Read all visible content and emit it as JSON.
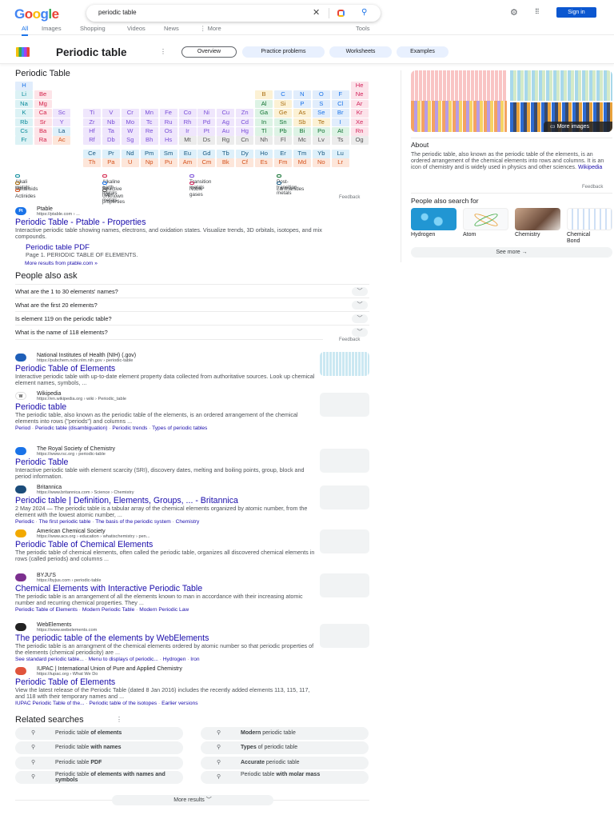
{
  "header": {
    "logo": "Google",
    "query": "periodic table",
    "sign_in": "Sign in",
    "tabs": [
      "All",
      "Images",
      "Shopping",
      "Videos",
      "News",
      "⋮ More"
    ],
    "tools": "Tools"
  },
  "kp": {
    "title": "Periodic table",
    "chips": [
      "Overview",
      "Practice problems",
      "Worksheets",
      "Examples"
    ],
    "table_heading": "Periodic Table",
    "rows": [
      [
        "H:nm",
        null,
        null,
        null,
        null,
        null,
        null,
        null,
        null,
        null,
        null,
        null,
        null,
        null,
        null,
        null,
        null,
        "He:ng"
      ],
      [
        "Li:al",
        "Be:ae",
        null,
        null,
        null,
        null,
        null,
        null,
        null,
        null,
        null,
        null,
        "B:md",
        "C:nm",
        "N:nm",
        "O:nm",
        "F:nm",
        "Ne:ng"
      ],
      [
        "Na:al",
        "Mg:ae",
        null,
        null,
        null,
        null,
        null,
        null,
        null,
        null,
        null,
        null,
        "Al:pt",
        "Si:md",
        "P:nm",
        "S:nm",
        "Cl:nm",
        "Ar:ng"
      ],
      [
        "K:al",
        "Ca:ae",
        "Sc:tm",
        "Ti:tm",
        "V:tm",
        "Cr:tm",
        "Mn:tm",
        "Fe:tm",
        "Co:tm",
        "Ni:tm",
        "Cu:tm",
        "Zn:tm",
        "Ga:pt",
        "Ge:md",
        "As:md",
        "Se:nm",
        "Br:nm",
        "Kr:ng"
      ],
      [
        "Rb:al",
        "Sr:ae",
        "Y:tm",
        "Zr:tm",
        "Nb:tm",
        "Mo:tm",
        "Tc:tm",
        "Ru:tm",
        "Rh:tm",
        "Pd:tm",
        "Ag:tm",
        "Cd:tm",
        "In:pt",
        "Sn:pt",
        "Sb:md",
        "Te:md",
        "I:nm",
        "Xe:ng"
      ],
      [
        "Cs:al",
        "Ba:ae",
        "La:ln",
        "Hf:tm",
        "Ta:tm",
        "W:tm",
        "Re:tm",
        "Os:tm",
        "Ir:tm",
        "Pt:tm",
        "Au:tm",
        "Hg:tm",
        "Tl:pt",
        "Pb:pt",
        "Bi:pt",
        "Po:pt",
        "At:pt",
        "Rn:ng"
      ],
      [
        "Fr:al",
        "Ra:ae",
        "Ac:ac",
        "Rf:tm",
        "Db:tm",
        "Sg:tm",
        "Bh:tm",
        "Hs:tm",
        "Mt:un",
        "Ds:un",
        "Rg:un",
        "Cn:un",
        "Nh:un",
        "Fl:un",
        "Mc:un",
        "Lv:un",
        "Ts:un",
        "Og:un"
      ]
    ],
    "lanthanides": [
      "Ce",
      "Pr",
      "Nd",
      "Pm",
      "Sm",
      "Eu",
      "Gd",
      "Tb",
      "Dy",
      "Ho",
      "Er",
      "Tm",
      "Yb",
      "Lu"
    ],
    "actinides": [
      "Th",
      "Pa",
      "U",
      "Np",
      "Pu",
      "Am",
      "Cm",
      "Bk",
      "Cf",
      "Es",
      "Fm",
      "Md",
      "No",
      "Lr"
    ],
    "categories": {
      "al": {
        "label": "Alkali metals",
        "bg": "#dcf2f5",
        "fg": "#0a8a9a"
      },
      "ae": {
        "label": "Alkaline earth metals",
        "bg": "#fde4e8",
        "fg": "#d3224a"
      },
      "tm": {
        "label": "Transition metals",
        "bg": "#efe6fc",
        "fg": "#7a4fd8"
      },
      "pt": {
        "label": "Post-transition metals",
        "bg": "#ddf3e5",
        "fg": "#137333"
      },
      "md": {
        "label": "Metalloids",
        "bg": "#fcf1d4",
        "fg": "#a86c0f"
      },
      "nm": {
        "label": "Reactive non-metals",
        "bg": "#e1edfc",
        "fg": "#1a73e8"
      },
      "ng": {
        "label": "Noble gases",
        "bg": "#fce3ea",
        "fg": "#d2245b"
      },
      "ln": {
        "label": "Lanthanides",
        "bg": "#def0fa",
        "fg": "#185a83"
      },
      "ac": {
        "label": "Actinides",
        "bg": "#fde6da",
        "fg": "#d4531d"
      },
      "un": {
        "label": "Unknown properties",
        "bg": "#ececec",
        "fg": "#555555"
      }
    },
    "legend_order": [
      "al",
      "ae",
      "tm",
      "pt",
      "md",
      "nm",
      "ng",
      "ln",
      "ac",
      "un"
    ],
    "feedback": "Feedback"
  },
  "panel": {
    "more_images": "More images",
    "about_heading": "About",
    "about_text": "The periodic table, also known as the periodic table of the elements, is an ordered arrangement of the chemical elements into rows and columns. It is an icon of chemistry and is widely used in physics and other sciences.",
    "about_source": "Wikipedia",
    "feedback": "Feedback",
    "pasf_heading": "People also search for",
    "pasf": [
      "Hydrogen",
      "Atom",
      "Chemistry",
      "Chemical Bond"
    ],
    "see_more": "See more"
  },
  "ptable": {
    "site": "Ptable",
    "url": "https://ptable.com › ...",
    "title": "Periodic Table - Ptable - Properties",
    "snippet": "Interactive periodic table showing names, electrons, and oxidation states. Visualize trends, 3D orbitals, isotopes, and mix compounds.",
    "sub_title": "Periodic table PDF",
    "sub_snippet": "Page 1. PERIODIC TABLE OF ELEMENTS.",
    "more": "More results from ptable.com »"
  },
  "paa": {
    "heading": "People also ask",
    "questions": [
      "What are the 1 to 30 elements' names?",
      "What are the first 20 elements?",
      "Is element 119 on the periodic table?",
      "What is the name of 118 elements?"
    ],
    "feedback": "Feedback"
  },
  "results": [
    {
      "site": "National Institutes of Health (NIH) (.gov)",
      "url": "https://pubchem.ncbi.nlm.nih.gov › periodic-table",
      "title": "Periodic Table of Elements",
      "snippet": "Interactive periodic table with up-to-date element property data collected from authoritative sources. Look up chemical element names, symbols, ...",
      "links": [],
      "fav": "#1f5fb8"
    },
    {
      "site": "Wikipedia",
      "url": "https://en.wikipedia.org › wiki › Periodic_table",
      "title": "Periodic table",
      "snippet": "The periodic table, also known as the periodic table of the elements, is an ordered arrangement of the chemical elements into rows (\"periods\") and columns ...",
      "links": [
        "Period",
        "Periodic table (disambiguation)",
        "Periodic trends",
        "Types of periodic tables"
      ],
      "fav": "#ffffff"
    },
    {
      "site": "The Royal Society of Chemistry",
      "url": "https://www.rsc.org › periodic-table",
      "title": "Periodic Table",
      "snippet": "Interactive periodic table with element scarcity (SRI), discovery dates, melting and boiling points, group, block and period information.",
      "links": [],
      "fav": "#1a73e8"
    },
    {
      "site": "Britannica",
      "url": "https://www.britannica.com › Science › Chemistry",
      "title": "Periodic table | Definition, Elements, Groups, ... - Britannica",
      "snippet": "2 May 2024 — The periodic table is a tabular array of the chemical elements organized by atomic number, from the element with the lowest atomic number, ...",
      "links": [
        "Periodic",
        "The first periodic table",
        "The basis of the periodic system",
        "Chemistry"
      ],
      "fav": "#1b4c7a"
    },
    {
      "site": "American Chemical Society",
      "url": "https://www.acs.org › education › whatischemistry › pen...",
      "title": "Periodic Table of Chemical Elements",
      "snippet": "The periodic table of chemical elements, often called the periodic table, organizes all discovered chemical elements in rows (called periods) and columns ...",
      "links": [],
      "fav": "#f2a900"
    },
    {
      "site": "BYJU'S",
      "url": "https://byjus.com › periodic-table",
      "title": "Chemical Elements with Interactive Periodic Table",
      "snippet": "The periodic table is an arrangement of all the elements known to man in accordance with their increasing atomic number and recurring chemical properties. They ...",
      "links": [
        "Periodic Table of Elements",
        "Modern Periodic Table",
        "Modern Periodic Law"
      ],
      "fav": "#7b2f8e"
    },
    {
      "site": "WebElements",
      "url": "https://www.webelements.com",
      "title": "The periodic table of the elements by WebElements",
      "snippet": "The periodic table is an arrangment of the chemical elements ordered by atomic number so that periodic properties of the elements (chemical periodicity) are ...",
      "links": [
        "See standard periodic table...",
        "Menu to displays of periodic...",
        "Hydrogen",
        "Iron"
      ],
      "fav": "#222222"
    },
    {
      "site": "IUPAC | International Union of Pure and Applied Chemistry",
      "url": "https://iupac.org › What We Do",
      "title": "Periodic Table of Elements",
      "snippet": "View the latest release of the Periodic Table (dated 8 Jan 2016) includes the recently added elements 113, 115, 117, and 118 with their temporary names and ...",
      "links": [
        "IUPAC Periodic Table of the...",
        "Periodic table of the isotopes",
        "Earlier versions"
      ],
      "fav": "#e0543c"
    }
  ],
  "related": {
    "heading": "Related searches",
    "items": [
      {
        "pre": "Periodic table ",
        "bold": "of elements",
        "post": ""
      },
      {
        "pre": "",
        "bold": "Modern",
        "post": " periodic table"
      },
      {
        "pre": "Periodic table ",
        "bold": "with names",
        "post": ""
      },
      {
        "pre": "",
        "bold": "Types",
        "post": " of periodic table"
      },
      {
        "pre": "Periodic table ",
        "bold": "PDF",
        "post": ""
      },
      {
        "pre": "",
        "bold": "Accurate",
        "post": " periodic table"
      },
      {
        "pre": "Periodic table ",
        "bold": "of elements with names and symbols",
        "post": ""
      },
      {
        "pre": "Periodic table ",
        "bold": "with molar mass",
        "post": ""
      }
    ],
    "more_results": "More results"
  },
  "colors": {
    "link": "#1a0dab",
    "accent": "#1a73e8",
    "signin": "#0b57d0"
  }
}
